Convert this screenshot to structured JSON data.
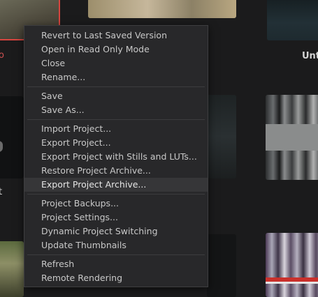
{
  "background": {
    "color": "#1b1b1c"
  },
  "grid_labels": {
    "untitled_fragment": "Unt",
    "left_fragment_top": "o",
    "left_fragment_mid": "t"
  },
  "menu": {
    "groups": [
      [
        "Revert to Last Saved Version",
        "Open in Read Only Mode",
        "Close",
        "Rename..."
      ],
      [
        "Save",
        "Save As..."
      ],
      [
        "Import Project...",
        "Export Project...",
        "Export Project with Stills and LUTs...",
        "Restore Project Archive...",
        "Export Project Archive..."
      ],
      [
        "Project Backups...",
        "Project Settings...",
        "Dynamic Project Switching",
        "Update Thumbnails"
      ],
      [
        "Refresh",
        "Remote Rendering"
      ]
    ],
    "highlighted": "Export Project Archive..."
  },
  "colors": {
    "selection_outline": "#d8453f",
    "menu_bg": "#28282a",
    "menu_text": "#c8c8c8",
    "hover_bg": "#363638"
  }
}
